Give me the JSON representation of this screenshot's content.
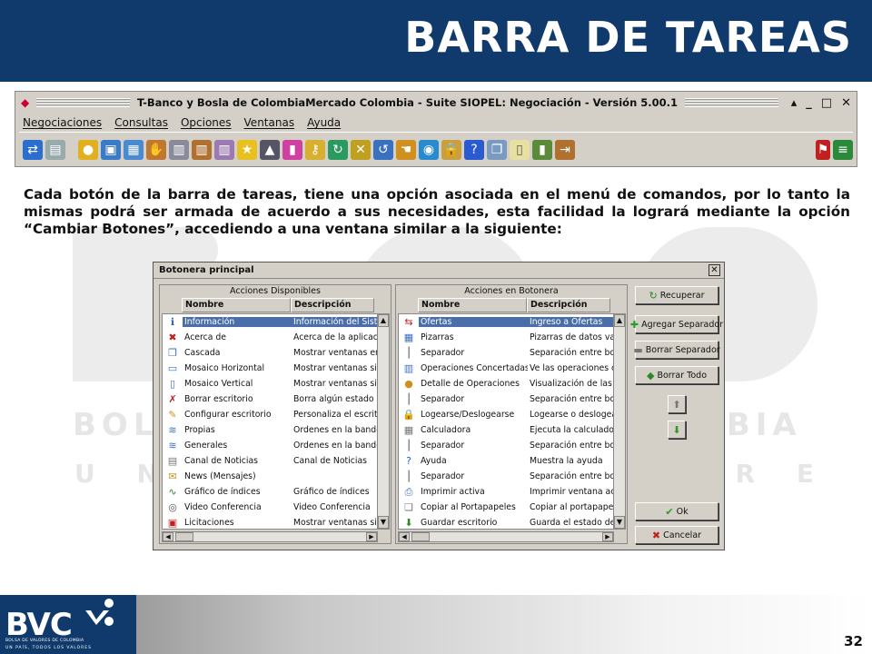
{
  "slide": {
    "title": "BARRA DE TAREAS",
    "page_number": "32",
    "paragraph": "Cada botón de la barra de tareas, tiene una opción asociada en el menú de comandos, por lo tanto la mismas podrá ser armada de acuerdo a sus necesidades, esta facilidad la logrará mediante la opción “Cambiar Botones”, accediendo a una ventana similar a la siguiente:"
  },
  "app_window": {
    "title": "T-Banco y Bosla de ColombiaMercado Colombia - Suite SIOPEL: Negociación - Versión 5.00.1",
    "menu": [
      "Negociaciones",
      "Consultas",
      "Opciones",
      "Ventanas",
      "Ayuda"
    ],
    "toolbar_icons": [
      "refresh-icon",
      "cash-register-icon",
      "coins-icon",
      "monitor-icon",
      "grid-icon",
      "handshake-icon",
      "calculator-icon",
      "calculator2-icon",
      "calculator3-icon",
      "star-icon",
      "graduation-icon",
      "chart-bars-icon",
      "key-icon",
      "sync-icon",
      "cross-arrows-icon",
      "sync2-icon",
      "hand-icon",
      "globe-icon",
      "lock-icon",
      "help-icon",
      "copy-icon",
      "page-icon",
      "bar-chart-icon",
      "exit-icon"
    ]
  },
  "dialog": {
    "title": "Botonera principal",
    "left_panel": {
      "title": "Acciones Disponibles",
      "columns": [
        "Nombre",
        "Descripción"
      ],
      "rows": [
        {
          "name": "Información",
          "desc": "Información del Sistem",
          "icon": "info-icon",
          "selected": true
        },
        {
          "name": "Acerca de",
          "desc": "Acerca de la aplicació",
          "icon": "about-icon"
        },
        {
          "name": "Cascada",
          "desc": "Mostrar ventanas en c",
          "icon": "cascade-icon"
        },
        {
          "name": "Mosaico Horizontal",
          "desc": "Mostrar ventanas sin s",
          "icon": "tile-horizontal-icon"
        },
        {
          "name": "Mosaico Vertical",
          "desc": "Mostrar ventanas sin s",
          "icon": "tile-vertical-icon"
        },
        {
          "name": "Borrar escritorio",
          "desc": "Borra algún estado de",
          "icon": "clear-desktop-icon"
        },
        {
          "name": "Configurar escritorio",
          "desc": "Personaliza el escrito",
          "icon": "config-desktop-icon"
        },
        {
          "name": "Propias",
          "desc": "Ordenes en la bandeja",
          "icon": "stack-icon"
        },
        {
          "name": "Generales",
          "desc": "Ordenes en la bandeja",
          "icon": "stack2-icon"
        },
        {
          "name": "Canal de Noticias",
          "desc": "Canal de Noticias",
          "icon": "newspaper-icon"
        },
        {
          "name": "News (Mensajes)",
          "desc": "",
          "icon": "mail-icon"
        },
        {
          "name": "Gráfico de índices",
          "desc": "Gráfico de índices",
          "icon": "chart-icon"
        },
        {
          "name": "Video Conferencia",
          "desc": "Video Conferencia",
          "icon": "video-icon"
        },
        {
          "name": "Licitaciones",
          "desc": "Mostrar ventanas sin",
          "icon": "tender-icon"
        }
      ]
    },
    "right_panel": {
      "title": "Acciones en Botonera",
      "columns": [
        "Nombre",
        "Descripción"
      ],
      "rows": [
        {
          "name": "Ofertas",
          "desc": "Ingreso a Ofertas",
          "icon": "offers-icon",
          "selected": true
        },
        {
          "name": "Pizarras",
          "desc": "Pizarras de datos vari",
          "icon": "board-icon"
        },
        {
          "name": "Separador",
          "desc": "Separación entre boto",
          "icon": "separator-icon"
        },
        {
          "name": "Operaciones Concertadas",
          "desc": "Ve las operaciones co",
          "icon": "operations-icon"
        },
        {
          "name": "Detalle de Operaciones",
          "desc": "Visualización de las O",
          "icon": "detail-icon"
        },
        {
          "name": "Separador",
          "desc": "Separación entre boto",
          "icon": "separator-icon"
        },
        {
          "name": "Logearse/Deslogearse",
          "desc": "Logearse o deslogear",
          "icon": "lock-icon"
        },
        {
          "name": "Calculadora",
          "desc": "Ejecuta la calculadora",
          "icon": "calculator-icon"
        },
        {
          "name": "Separador",
          "desc": "Separación entre boto",
          "icon": "separator-icon"
        },
        {
          "name": "Ayuda",
          "desc": "Muestra la ayuda",
          "icon": "help-icon"
        },
        {
          "name": "Separador",
          "desc": "Separación entre boto",
          "icon": "separator-icon"
        },
        {
          "name": "Imprimir activa",
          "desc": "Imprimir ventana activa",
          "icon": "print-icon"
        },
        {
          "name": "Copiar al Portapapeles",
          "desc": "Copiar al portapapeles",
          "icon": "clipboard-icon"
        },
        {
          "name": "Guardar escritorio",
          "desc": "Guarda el estado de la",
          "icon": "save-desktop-icon"
        }
      ]
    },
    "buttons": {
      "recuperar": "Recuperar",
      "agregar_separador": "Agregar Separador",
      "borrar_separador": "Borrar Separador",
      "borrar_todo": "Borrar Todo",
      "ok": "Ok",
      "cancelar": "Cancelar"
    }
  },
  "watermark": {
    "line1_left": "BOLSA",
    "line1_right": "MBIA",
    "line2_left": "U N",
    "line2_right": "O R E S"
  },
  "footer": {
    "logo": "BVC",
    "logo_sub1": "BOLSA DE VALORES DE COLOMBIA",
    "logo_sub2": "UN PAÍS, TODOS LOS VALORES"
  },
  "colors": {
    "navy": "#0f3a6b",
    "selection": "#4a6ea9",
    "window_gray": "#d4d0c8"
  }
}
